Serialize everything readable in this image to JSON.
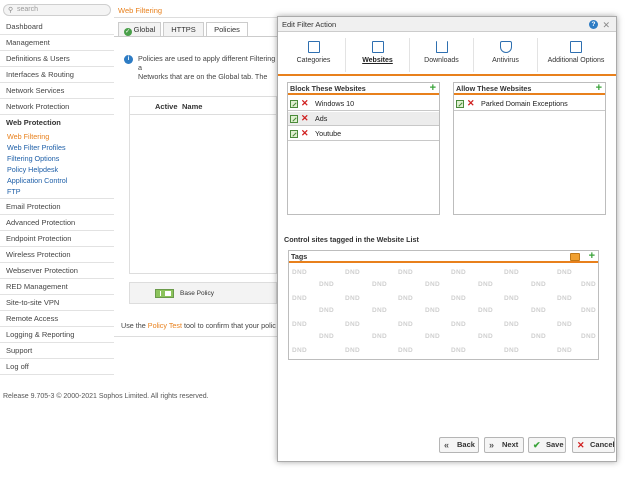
{
  "search": {
    "placeholder": "search"
  },
  "sidebar": {
    "items": [
      {
        "label": "Dashboard"
      },
      {
        "label": "Management"
      },
      {
        "label": "Definitions & Users"
      },
      {
        "label": "Interfaces & Routing"
      },
      {
        "label": "Network Services"
      },
      {
        "label": "Network Protection"
      }
    ],
    "web_protection": {
      "label": "Web Protection",
      "subitems": [
        {
          "label": "Web Filtering"
        },
        {
          "label": "Web Filter Profiles"
        },
        {
          "label": "Filtering Options"
        },
        {
          "label": "Policy Helpdesk"
        },
        {
          "label": "Application Control"
        },
        {
          "label": "FTP"
        }
      ]
    },
    "items_after": [
      {
        "label": "Email Protection"
      },
      {
        "label": "Advanced Protection"
      },
      {
        "label": "Endpoint Protection"
      },
      {
        "label": "Wireless Protection"
      },
      {
        "label": "Webserver Protection"
      },
      {
        "label": "RED Management"
      },
      {
        "label": "Site-to-site VPN"
      },
      {
        "label": "Remote Access"
      },
      {
        "label": "Logging & Reporting"
      },
      {
        "label": "Support"
      },
      {
        "label": "Log off"
      }
    ]
  },
  "footer": {
    "text": "Release 9.705-3  © 2000-2021 Sophos Limited. All rights reserved."
  },
  "main": {
    "title": "Web Filtering",
    "tabs": [
      {
        "label": "Global"
      },
      {
        "label": "HTTPS"
      },
      {
        "label": "Policies"
      }
    ],
    "info_text": "Policies are used to apply different Filtering a\nNetworks that are on the Global tab. The firs\nothers match.",
    "table": {
      "col_active": "Active",
      "col_name": "Name"
    },
    "base_policy": "Base Policy",
    "use_text_before": "Use the ",
    "use_text_link": "Policy Test",
    "use_text_after": " tool to confirm that your polic"
  },
  "dialog": {
    "title": "Edit Filter Action",
    "help": "?",
    "close": "✕",
    "tabs": [
      {
        "label": "Categories"
      },
      {
        "label": "Websites"
      },
      {
        "label": "Downloads"
      },
      {
        "label": "Antivirus"
      },
      {
        "label": "Additional Options"
      }
    ],
    "block": {
      "title": "Block These Websites",
      "rows": [
        {
          "text": "Windows 10"
        },
        {
          "text": "Ads"
        },
        {
          "text": "Youtube"
        }
      ]
    },
    "allow": {
      "title": "Allow These Websites",
      "rows": [
        {
          "text": "Parked Domain Exceptions"
        }
      ]
    },
    "control_label": "Control sites tagged in the Website List",
    "tags": {
      "title": "Tags",
      "watermark": "DND"
    },
    "buttons": {
      "back": "Back",
      "next": "Next",
      "save": "Save",
      "cancel": "Cancel"
    }
  },
  "colors": {
    "accent": "#e8801c",
    "link": "#1e5fa8",
    "add_green": "#3aa33a",
    "delete_red": "#d02020"
  }
}
